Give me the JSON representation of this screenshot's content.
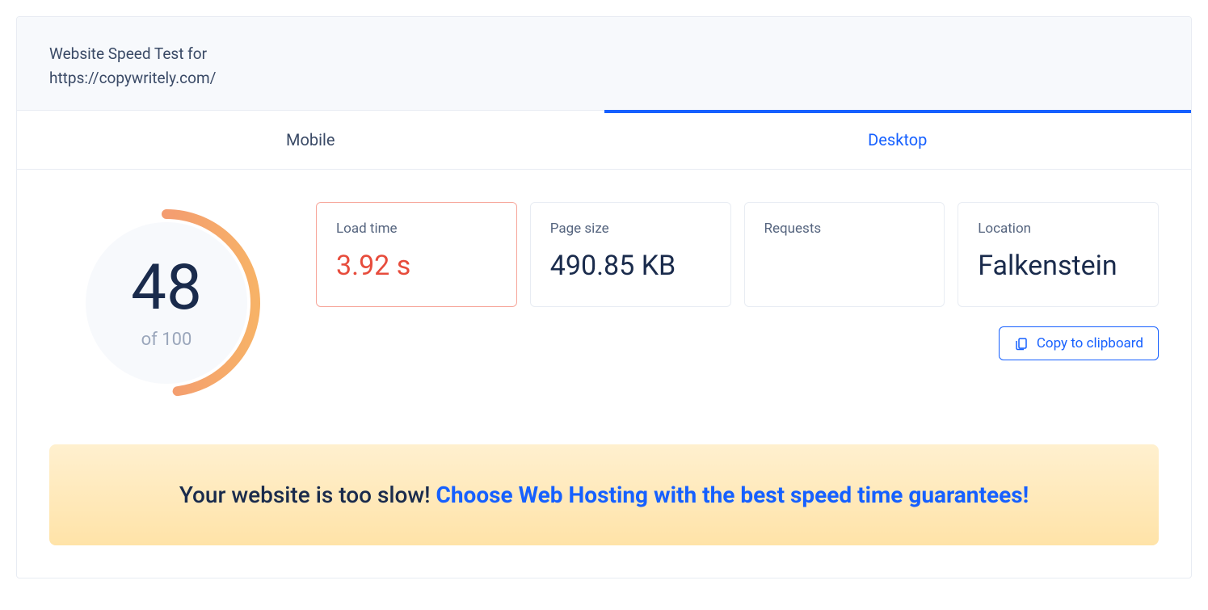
{
  "header": {
    "title": "Website Speed Test for",
    "url": "https://copywritely.com/"
  },
  "tabs": [
    {
      "label": "Mobile",
      "active": false
    },
    {
      "label": "Desktop",
      "active": true
    }
  ],
  "gauge": {
    "score": "48",
    "of_label": "of 100",
    "percent": 48
  },
  "metrics": [
    {
      "label": "Load time",
      "value": "3.92 s",
      "highlight": true
    },
    {
      "label": "Page size",
      "value": "490.85 KB",
      "highlight": false
    },
    {
      "label": "Requests",
      "value": "",
      "highlight": false
    },
    {
      "label": "Location",
      "value": "Falkenstein",
      "highlight": false
    }
  ],
  "copy_button": {
    "label": "Copy to clipboard"
  },
  "banner": {
    "plain": "Your website is too slow! ",
    "link": "Choose Web Hosting with the best speed time guarantees!"
  },
  "colors": {
    "accent": "#1660ff",
    "gauge_start": "#f08779",
    "gauge_end": "#f7b267"
  }
}
